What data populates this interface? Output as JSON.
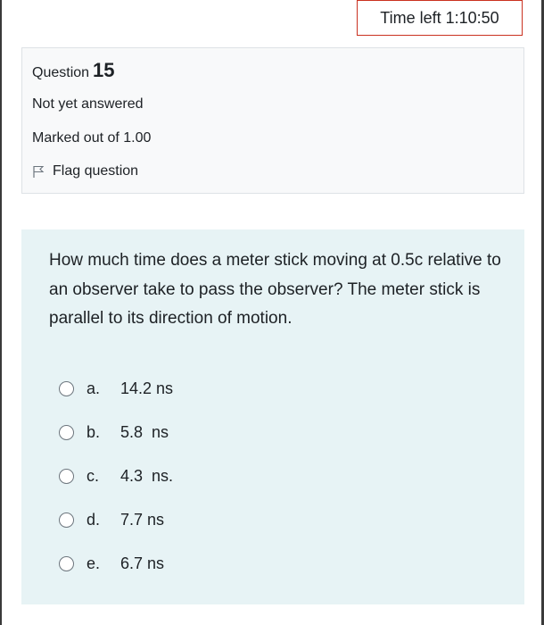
{
  "timer": {
    "label": "Time left 1:10:50"
  },
  "info": {
    "question_label": "Question",
    "question_number": "15",
    "state": "Not yet answered",
    "grade": "Marked out of 1.00",
    "flag_label": "Flag question"
  },
  "question": {
    "text": "How much time does a meter stick moving at 0.5c relative to an observer take to pass the observer? The meter stick is parallel to its direction of motion.",
    "answers": [
      {
        "letter": "a.",
        "text": "14.2 ns"
      },
      {
        "letter": "b.",
        "text": "5.8  ns"
      },
      {
        "letter": "c.",
        "text": "4.3  ns."
      },
      {
        "letter": "d.",
        "text": "7.7 ns"
      },
      {
        "letter": "e.",
        "text": "6.7 ns"
      }
    ]
  },
  "icons": {
    "flag": "flag-icon",
    "radio": "radio-unchecked-icon"
  },
  "colors": {
    "content_bg": "#e7f3f5",
    "info_bg": "#f8f9fa",
    "timer_border": "#ca3120"
  }
}
